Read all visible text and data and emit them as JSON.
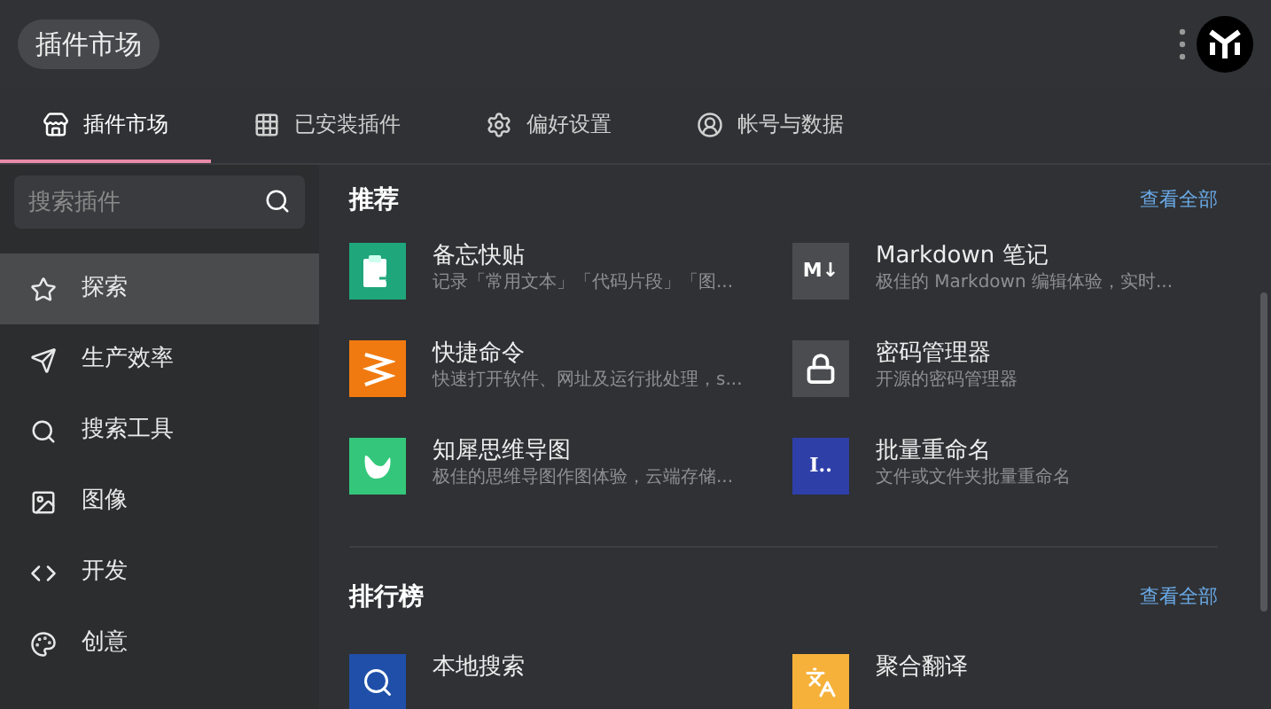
{
  "window": {
    "title": "插件市场"
  },
  "tabs": [
    {
      "label": "插件市场",
      "selected": true
    },
    {
      "label": "已安装插件",
      "selected": false
    },
    {
      "label": "偏好设置",
      "selected": false
    },
    {
      "label": "帐号与数据",
      "selected": false
    }
  ],
  "search": {
    "placeholder": "搜索插件"
  },
  "sidebar": {
    "items": [
      {
        "label": "探索",
        "selected": true
      },
      {
        "label": "生产效率",
        "selected": false
      },
      {
        "label": "搜索工具",
        "selected": false
      },
      {
        "label": "图像",
        "selected": false
      },
      {
        "label": "开发",
        "selected": false
      },
      {
        "label": "创意",
        "selected": false
      }
    ]
  },
  "sections": [
    {
      "title": "推荐",
      "link": "查看全部",
      "items": [
        {
          "name": "备忘快贴",
          "description": "记录「常用文本」「代码片段」「图..."
        },
        {
          "name": "Markdown 笔记",
          "description": "极佳的 Markdown 编辑体验，实时...",
          "icon_text": "M↓"
        },
        {
          "name": "快捷命令",
          "description": "快速打开软件、网址及运行批处理，s..."
        },
        {
          "name": "密码管理器",
          "description": "开源的密码管理器"
        },
        {
          "name": "知犀思维导图",
          "description": "极佳的思维导图作图体验，云端存储..."
        },
        {
          "name": "批量重命名",
          "description": "文件或文件夹批量重命名",
          "icon_text": "I.."
        }
      ]
    },
    {
      "title": "排行榜",
      "link": "查看全部",
      "items": [
        {
          "name": "本地搜索"
        },
        {
          "name": "聚合翻译"
        }
      ]
    }
  ]
}
